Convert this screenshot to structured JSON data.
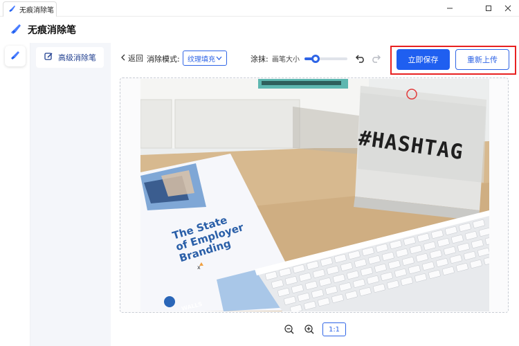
{
  "window": {
    "tab_title": "无痕消除笔",
    "controls": [
      "minimize-icon",
      "restore-icon",
      "close-icon"
    ]
  },
  "header": {
    "app_title": "无痕消除笔",
    "logo_icon": "eraser-brush-icon"
  },
  "sidebar": {
    "items": [
      {
        "label": "高级消除笔",
        "icon": "edit-square-icon",
        "active": true
      }
    ]
  },
  "toolbar": {
    "back_label": "返回",
    "mode_label": "消除模式:",
    "mode_value": "纹理填充",
    "smear_label": "涂抹:",
    "brush_size_label": "画笔大小",
    "brush_size_fraction": 0.25,
    "save_label": "立即保存",
    "reupload_label": "重新上传"
  },
  "photo": {
    "brochure_lines": [
      "The State",
      "of Employer",
      "Branding"
    ],
    "lightbox_text": "#HASHTAG",
    "brochure_footer": "WALLS"
  },
  "zoom": {
    "ratio_label": "1:1"
  },
  "colors": {
    "accent": "#1f5ff0",
    "highlight_frame": "#e82020",
    "sidebar_bg": "#f4f6fa"
  }
}
